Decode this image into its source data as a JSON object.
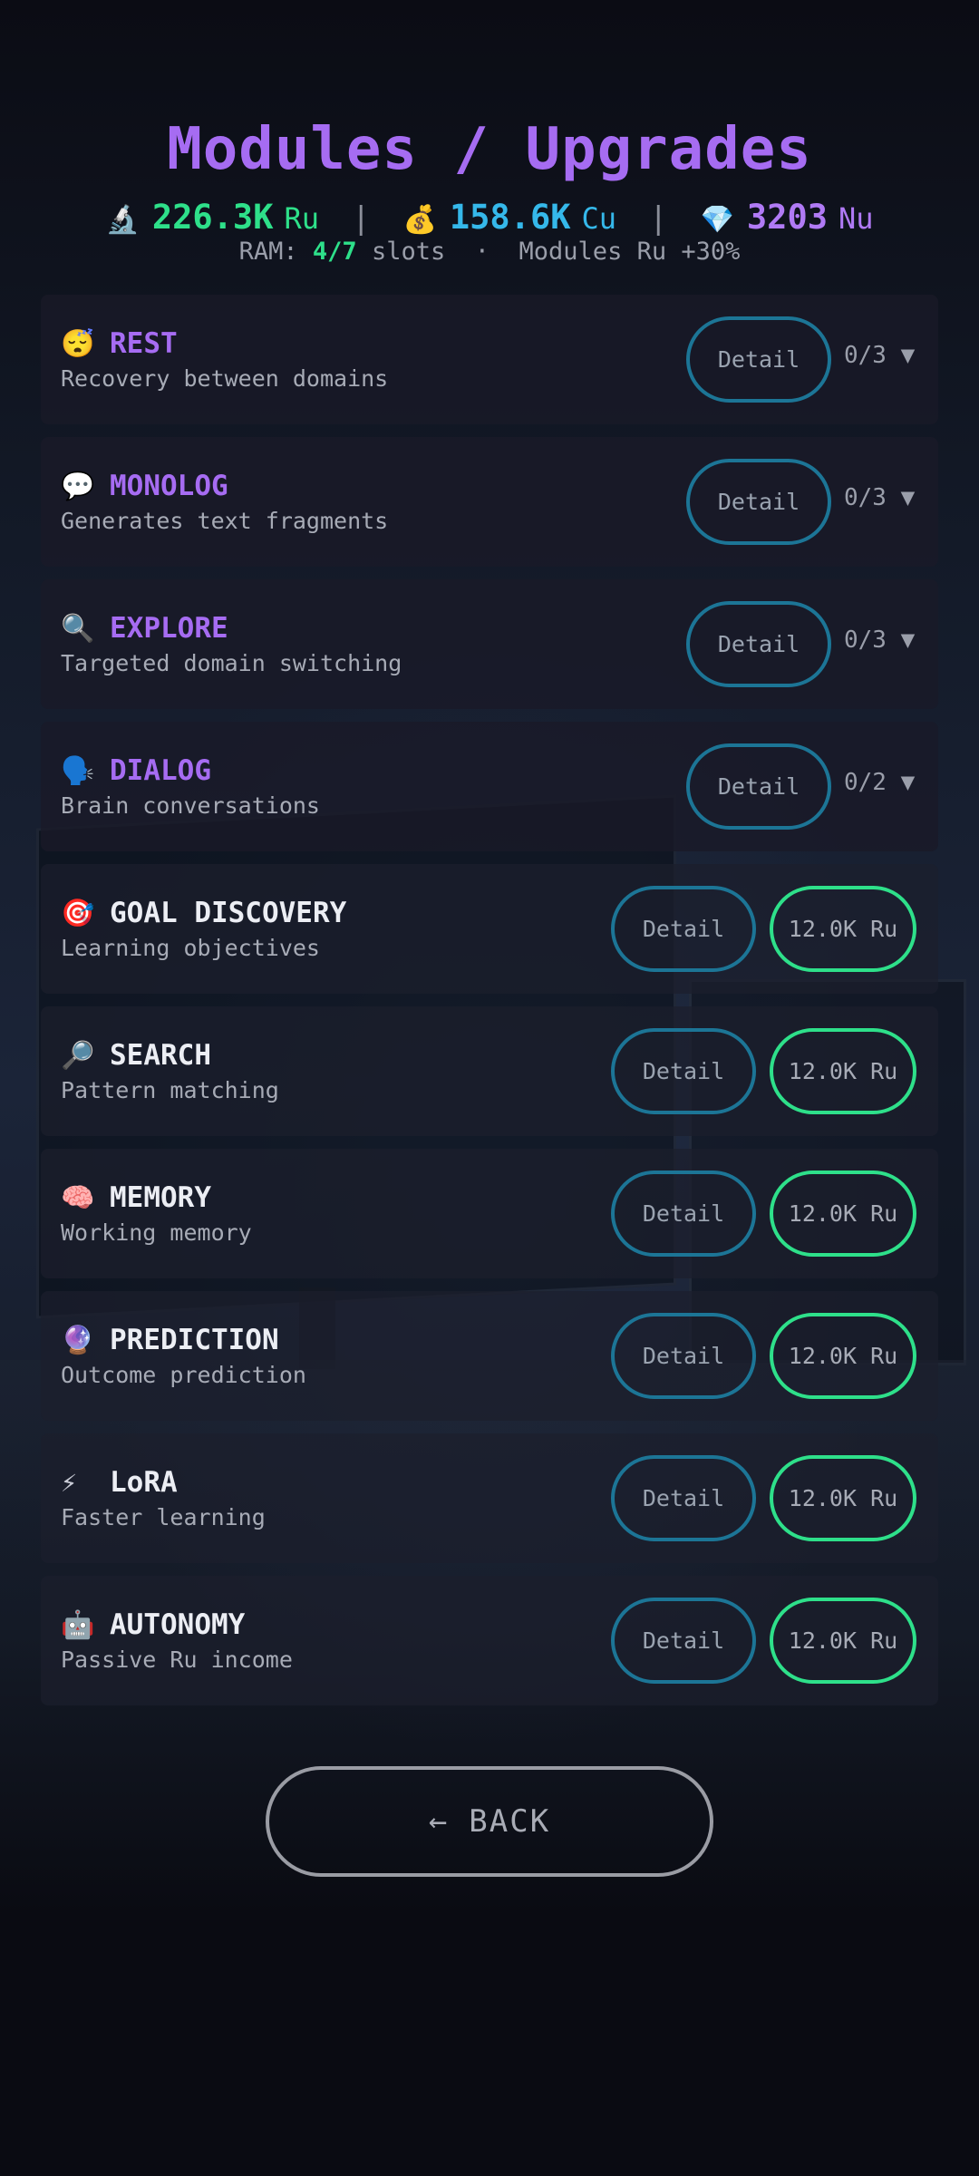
{
  "header": {
    "title": "Modules / Upgrades",
    "stats": [
      {
        "emoji": "🔬",
        "icon": "microscope-icon",
        "value": "226.3K",
        "unit": "Ru",
        "color": "#2ee08a"
      },
      {
        "emoji": "💰",
        "icon": "money-bag-icon",
        "value": "158.6K",
        "unit": "Cu",
        "color": "#35b8ea"
      },
      {
        "emoji": "💎",
        "icon": "gem-icon",
        "value": "3203",
        "unit": "Nu",
        "color": "#b07af5"
      }
    ],
    "separator": "|",
    "ram_label": "RAM:",
    "ram_value": "4/7",
    "ram_suffix": "slots",
    "dot": "·",
    "bonus": "Modules Ru +30%"
  },
  "modules": [
    {
      "icon": "😴",
      "icon_name": "sleeping-face-icon",
      "name": "REST",
      "desc": "Recovery between domains",
      "detail": "Detail",
      "level": "0/3 ▼"
    },
    {
      "icon": "💬",
      "icon_name": "speech-bubble-icon",
      "name": "MONOLOG",
      "desc": "Generates text fragments",
      "detail": "Detail",
      "level": "0/3 ▼"
    },
    {
      "icon": "🔍",
      "icon_name": "magnifier-left-icon",
      "name": "EXPLORE",
      "desc": "Targeted domain switching",
      "detail": "Detail",
      "level": "0/3 ▼"
    },
    {
      "icon": "🗣️",
      "icon_name": "speaking-head-icon",
      "name": "DIALOG",
      "desc": "Brain conversations",
      "detail": "Detail",
      "level": "0/2 ▼"
    },
    {
      "icon": "🎯",
      "icon_name": "target-icon",
      "name": "GOAL DISCOVERY",
      "desc": "Learning objectives",
      "detail": "Detail",
      "price": "12.0K Ru"
    },
    {
      "icon": "🔎",
      "icon_name": "magnifier-right-icon",
      "name": "SEARCH",
      "desc": "Pattern matching",
      "detail": "Detail",
      "price": "12.0K Ru"
    },
    {
      "icon": "🧠",
      "icon_name": "brain-icon",
      "name": "MEMORY",
      "desc": "Working memory",
      "detail": "Detail",
      "price": "12.0K Ru"
    },
    {
      "icon": "🔮",
      "icon_name": "crystal-ball-icon",
      "name": "PREDICTION",
      "desc": "Outcome prediction",
      "detail": "Detail",
      "price": "12.0K Ru"
    },
    {
      "icon": "⚡",
      "icon_name": "lightning-icon",
      "name": "LoRA",
      "desc": "Faster learning",
      "detail": "Detail",
      "price": "12.0K Ru"
    },
    {
      "icon": "🤖",
      "icon_name": "robot-icon",
      "name": "AUTONOMY",
      "desc": "Passive Ru income",
      "detail": "Detail",
      "price": "12.0K Ru"
    }
  ],
  "back": {
    "arrow": "←",
    "label": "BACK"
  },
  "colors": {
    "title": "#a66cf2",
    "ru": "#2ee08a",
    "cu": "#35b8ea",
    "nu": "#b07af5",
    "detail_border": "#1c7596",
    "buy_border": "#2ee08a"
  }
}
